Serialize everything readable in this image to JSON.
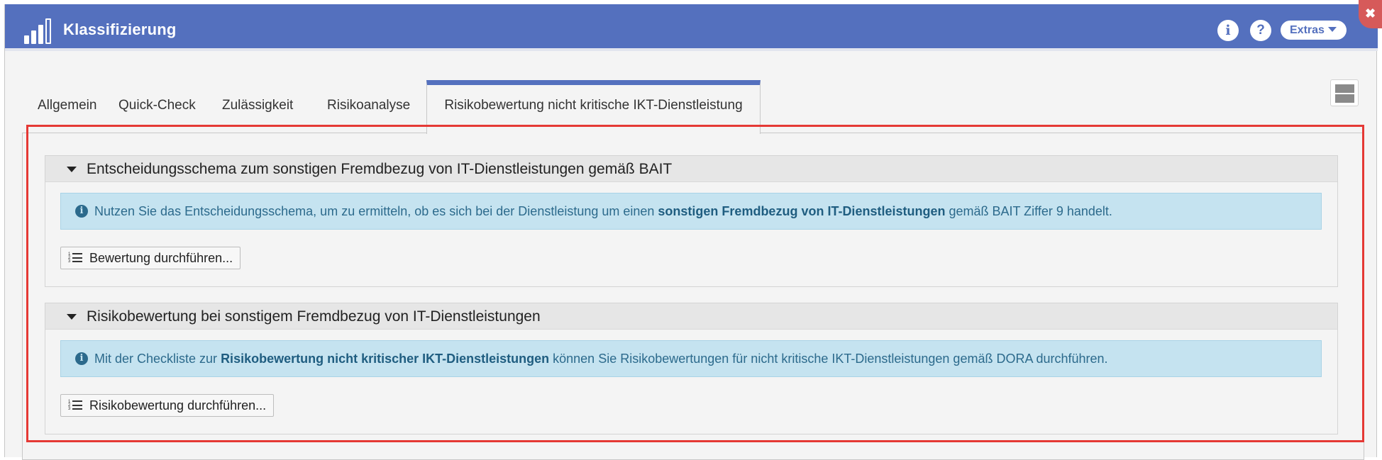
{
  "window": {
    "title": "Klassifizierung",
    "extras_label": "Extras",
    "close_glyph": "✖",
    "info_glyph": "i",
    "help_glyph": "?"
  },
  "tabs": [
    {
      "label": "Allgemein"
    },
    {
      "label": "Quick-Check"
    },
    {
      "label": "Zulässigkeit"
    },
    {
      "label": "Risikoanalyse"
    },
    {
      "label": "Risikobewertung nicht kritische IKT-Dienstleistung",
      "active": true
    }
  ],
  "panels": [
    {
      "title": "Entscheidungsschema zum sonstigen Fremdbezug von IT-Dienstleistungen gemäß BAIT",
      "info_before": "Nutzen Sie das Entscheidungsschema, um zu ermitteln, ob es sich bei der Dienstleistung um einen ",
      "info_bold": "sonstigen Fremdbezug von IT-Dienstleistungen",
      "info_after": " gemäß BAIT Ziffer 9 handelt.",
      "button_label": "Bewertung durchführen..."
    },
    {
      "title": "Risikobewertung bei sonstigem Fremdbezug von IT-Dienstleistungen",
      "info_before": "Mit der Checkliste zur ",
      "info_bold": "Risikobewertung nicht kritischer IKT-Dienstleistungen",
      "info_after": " können Sie Risikobewertungen für nicht kritische IKT-Dienstleistungen gemäß DORA durchführen.",
      "button_label": "Risikobewertung durchführen..."
    }
  ],
  "colors": {
    "titlebar": "#5470be",
    "info_background": "#c5e3f0",
    "info_text": "#2c6a8c",
    "highlight_border": "#e53935",
    "close_button": "#d65a5a"
  },
  "icons": {
    "app": "bar-chart-icon",
    "info": "info-circle-icon",
    "help": "question-circle-icon",
    "extras": "caret-down-icon",
    "close": "close-icon",
    "layout": "layout-rows-icon",
    "collapse": "triangle-down-icon",
    "list": "ordered-list-icon"
  }
}
